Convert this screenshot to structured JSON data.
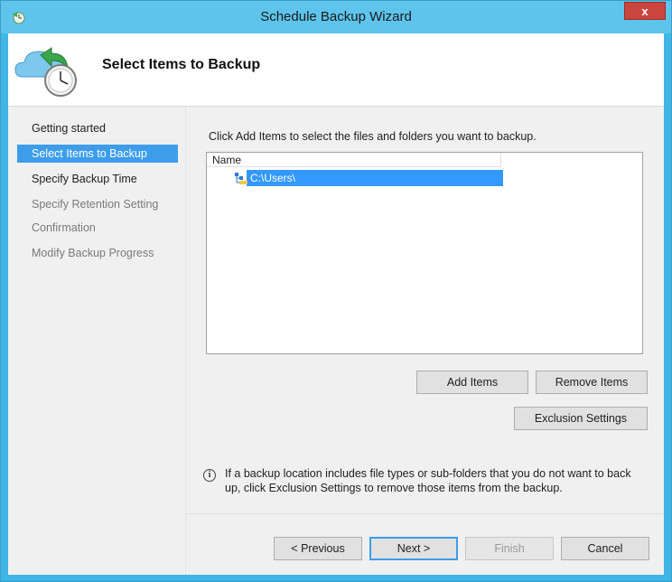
{
  "window": {
    "title": "Schedule Backup Wizard",
    "close_label": "x"
  },
  "header": {
    "title": "Select Items to Backup"
  },
  "nav": {
    "items": [
      {
        "label": "Getting started",
        "state": "done"
      },
      {
        "label": "Select Items to Backup",
        "state": "active"
      },
      {
        "label": "Specify Backup Time",
        "state": "next"
      },
      {
        "label": "Specify Retention Setting",
        "state": "future"
      },
      {
        "label": "Confirmation",
        "state": "future"
      },
      {
        "label": "Modify Backup Progress",
        "state": "future"
      }
    ]
  },
  "main": {
    "instruction": "Click Add Items to select the files and folders you want to backup.",
    "list": {
      "column_header": "Name",
      "rows": [
        {
          "name": "C:\\Users\\",
          "selected": true
        }
      ]
    },
    "add_items_label": "Add Items",
    "remove_items_label": "Remove Items",
    "exclusion_settings_label": "Exclusion Settings",
    "info_text": "If a backup location includes file types or sub-folders that you do not want to back up, click Exclusion Settings to remove those items from the backup."
  },
  "footer": {
    "previous_label": "< Previous",
    "next_label": "Next >",
    "finish_label": "Finish",
    "cancel_label": "Cancel"
  },
  "colors": {
    "titlebar": "#5ec4ec",
    "nav_active": "#3d9dea",
    "selection": "#3399ff",
    "close_button": "#c8463d"
  }
}
